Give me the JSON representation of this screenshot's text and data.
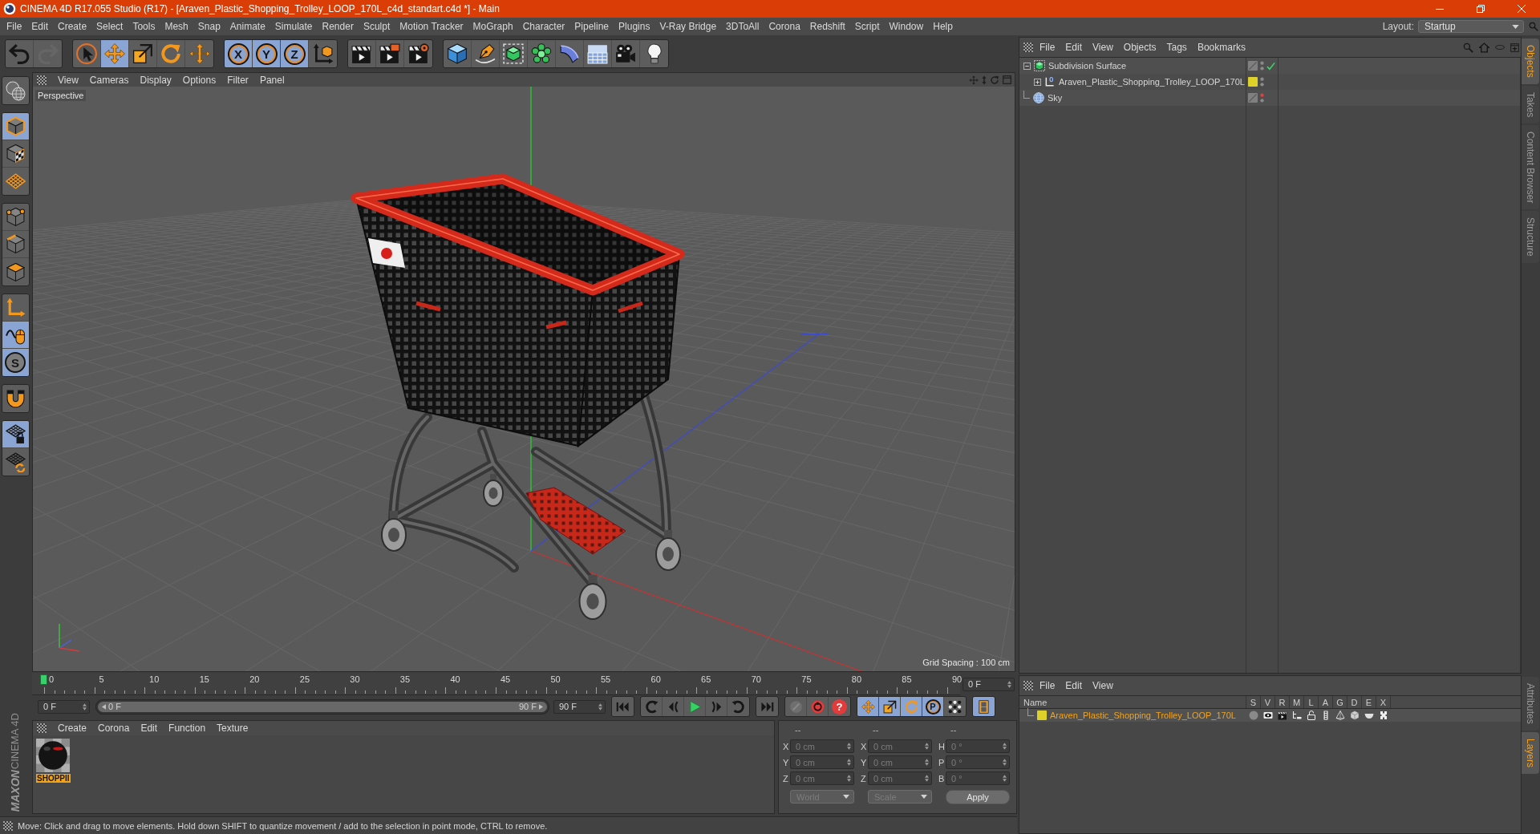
{
  "window": {
    "title": "CINEMA 4D R17.055 Studio (R17) - [Araven_Plastic_Shopping_Trolley_LOOP_170L_c4d_standart.c4d *] - Main"
  },
  "menu_bar": {
    "items": [
      "File",
      "Edit",
      "Create",
      "Select",
      "Tools",
      "Mesh",
      "Snap",
      "Animate",
      "Simulate",
      "Render",
      "Sculpt",
      "Motion Tracker",
      "MoGraph",
      "Character",
      "Pipeline",
      "Plugins",
      "V-Ray Bridge",
      "3DToAll",
      "Corona",
      "Redshift",
      "Script",
      "Window",
      "Help"
    ],
    "layout_label": "Layout:",
    "layout_value": "Startup"
  },
  "toolbar": [
    [
      {
        "on": false,
        "disabled": false
      },
      {
        "on": false,
        "disabled": true
      }
    ],
    [
      {
        "on": false
      },
      {
        "on": true
      },
      {
        "on": false
      },
      {
        "on": false
      },
      {
        "on": false
      }
    ],
    [
      {
        "label": "X",
        "on": true
      },
      {
        "label": "Y",
        "on": true
      },
      {
        "label": "Z",
        "on": true
      },
      {
        "on": false
      }
    ],
    [
      {
        "on": false
      },
      {
        "on": false
      },
      {
        "on": false
      }
    ],
    [
      {
        "on": false
      },
      {
        "on": false
      },
      {
        "on": false
      },
      {
        "on": false
      },
      {
        "on": false
      },
      {
        "on": false
      },
      {
        "on": false
      },
      {
        "on": false
      }
    ]
  ],
  "mode_toolbar": [
    [
      {
        "on": false
      }
    ],
    [
      {
        "on": true
      },
      {
        "on": false
      },
      {
        "on": false
      }
    ],
    [
      {
        "on": false
      },
      {
        "on": false
      },
      {
        "on": false
      }
    ],
    [
      {
        "on": false
      },
      {
        "on": true
      },
      {
        "label": "S",
        "on": true
      }
    ],
    [
      {
        "on": false
      }
    ],
    [
      {
        "on": true
      },
      {
        "on": false
      }
    ]
  ],
  "logo": {
    "brand": "MAXON",
    "product": "CINEMA 4D"
  },
  "viewport": {
    "menu": [
      "View",
      "Cameras",
      "Display",
      "Options",
      "Filter",
      "Panel"
    ],
    "camera_label": "Perspective",
    "grid_spacing": "Grid Spacing : 100 cm"
  },
  "timeline": {
    "ticks": [
      "0",
      "5",
      "10",
      "15",
      "20",
      "25",
      "30",
      "35",
      "40",
      "45",
      "50",
      "55",
      "60",
      "65",
      "70",
      "75",
      "80",
      "85",
      "90"
    ],
    "level": 0,
    "current_frame": "0 F",
    "start_field": "0 F",
    "range": {
      "start": "0 F",
      "end": "90 F",
      "level": 1
    },
    "end_field": "90 F",
    "transport": [
      [
        {
          "on": false
        }
      ],
      [
        {
          "on": false
        },
        {
          "on": false
        },
        {
          "on": false
        },
        {
          "on": false
        },
        {
          "on": false
        }
      ],
      [
        {
          "on": false
        }
      ],
      [
        {
          "on": false,
          "disabled": true
        },
        {
          "on": false,
          "disabled": false
        },
        {
          "label": "?",
          "on": false,
          "disabled": false
        }
      ],
      [
        {
          "on": true
        },
        {
          "on": true
        },
        {
          "on": true
        },
        {
          "label": "P",
          "on": true
        },
        {
          "on": false
        }
      ],
      [
        {
          "on": true
        }
      ]
    ]
  },
  "material_manager": {
    "menu": [
      "Create",
      "Corona",
      "Edit",
      "Function",
      "Texture"
    ],
    "materials": [
      {
        "name": "SHOPPII",
        "selected": true
      }
    ]
  },
  "coordinates": {
    "disabled": true,
    "columns": [
      {
        "header": "--",
        "fields": [
          {
            "label": "X",
            "value": "0 cm"
          },
          {
            "label": "Y",
            "value": "0 cm"
          },
          {
            "label": "Z",
            "value": "0 cm"
          }
        ]
      },
      {
        "header": "--",
        "fields": [
          {
            "label": "X",
            "value": "0 cm"
          },
          {
            "label": "Y",
            "value": "0 cm"
          },
          {
            "label": "Z",
            "value": "0 cm"
          }
        ]
      },
      {
        "header": "--",
        "fields": [
          {
            "label": "H",
            "value": "0 °"
          },
          {
            "label": "P",
            "value": "0 °"
          },
          {
            "label": "B",
            "value": "0 °"
          }
        ]
      }
    ],
    "dropdowns": [
      "World",
      "Scale"
    ],
    "apply": "Apply"
  },
  "status_bar": {
    "text": "Move: Click and drag to move elements. Hold down SHIFT to quantize movement / add to the selection in point mode, CTRL to remove."
  },
  "object_manager": {
    "menu": [
      "File",
      "Edit",
      "View",
      "Objects",
      "Tags",
      "Bookmarks"
    ],
    "objects": [
      {
        "name": "Subdivision Surface",
        "kind": "subdivision",
        "selected": false,
        "expanded": true,
        "editor_hidden": false,
        "enabled": true,
        "children": [
          {
            "name": "Araven_Plastic_Shopping_Trolley_LOOP_170L",
            "kind": "null",
            "selected": false,
            "expanded": false,
            "editor_hidden": false,
            "color": "#ddd12a"
          }
        ]
      },
      {
        "name": "Sky",
        "kind": "sky",
        "selected": false,
        "editor_hidden": true
      }
    ],
    "tabs": [
      {
        "label": "Objects",
        "selected": true
      },
      {
        "label": "Takes",
        "selected": false
      },
      {
        "label": "Content Browser",
        "selected": false
      },
      {
        "label": "Structure",
        "selected": false
      }
    ]
  },
  "layer_manager": {
    "menu": [
      "File",
      "Edit",
      "View"
    ],
    "columns": [
      "Name",
      "S",
      "V",
      "R",
      "M",
      "L",
      "A",
      "G",
      "D",
      "E",
      "X"
    ],
    "layers": [
      {
        "name": "Araven_Plastic_Shopping_Trolley_LOOP_170L",
        "color": "#ddd12a",
        "selected": true
      }
    ],
    "tabs": [
      {
        "label": "Attributes",
        "selected": false
      },
      {
        "label": "Layers",
        "selected": true
      }
    ]
  }
}
